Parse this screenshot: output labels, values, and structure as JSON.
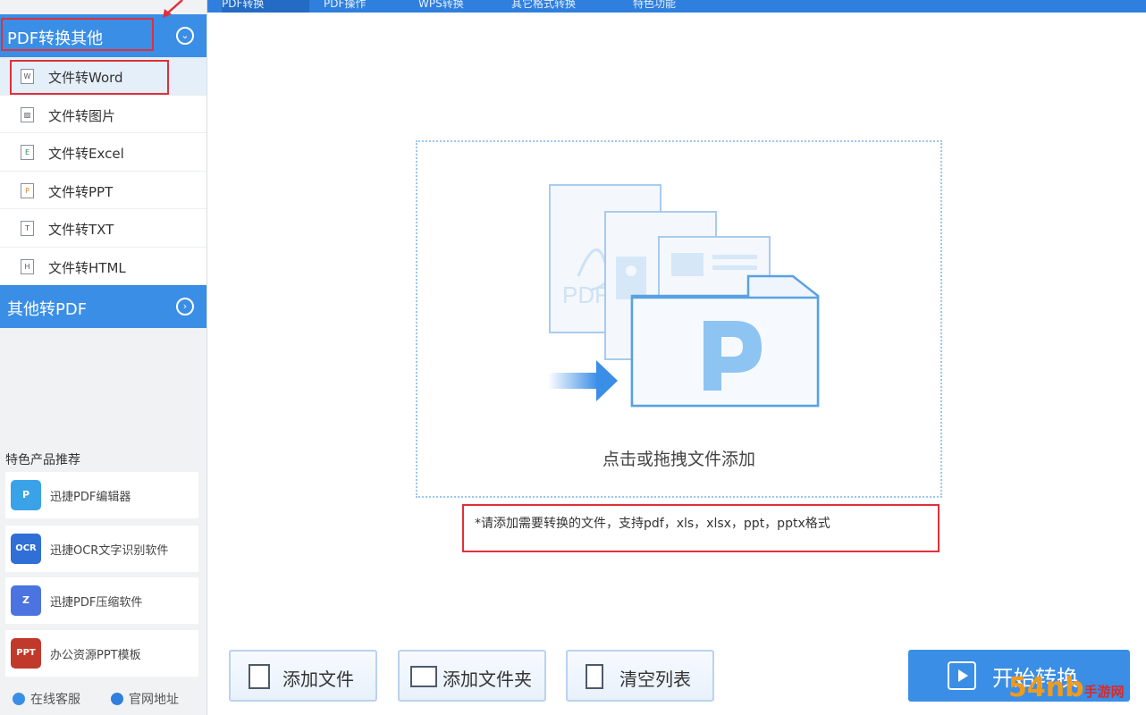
{
  "top_tabs": [
    {
      "label": "PDF转换",
      "active": true
    },
    {
      "label": "PDF操作",
      "active": false
    },
    {
      "label": "WPS转换",
      "active": false
    },
    {
      "label": "其它格式转换",
      "active": false
    },
    {
      "label": "特色功能",
      "active": false
    }
  ],
  "sidebar": {
    "group1": {
      "label": "PDF转换其他",
      "icon": "chevron-down-icon"
    },
    "items": [
      {
        "label": "文件转Word",
        "icon": "W",
        "active": true
      },
      {
        "label": "文件转图片",
        "icon": "img",
        "active": false
      },
      {
        "label": "文件转Excel",
        "icon": "E",
        "active": false
      },
      {
        "label": "文件转PPT",
        "icon": "P",
        "active": false
      },
      {
        "label": "文件转TXT",
        "icon": "T",
        "active": false
      },
      {
        "label": "文件转HTML",
        "icon": "H",
        "active": false
      }
    ],
    "group2": {
      "label": "其他转PDF",
      "icon": "chevron-right-icon"
    },
    "featured_title": "特色产品推荐",
    "products": [
      {
        "label": "迅捷PDF编辑器",
        "badge": "P",
        "color": "#3aa3e8"
      },
      {
        "label": "迅捷OCR文字识别软件",
        "badge": "OCR",
        "color": "#2f6fd6"
      },
      {
        "label": "迅捷PDF压缩软件",
        "badge": "Z",
        "color": "#4c74e0"
      },
      {
        "label": "办公资源PPT模板",
        "badge": "PPT",
        "color": "#c0392b"
      }
    ],
    "footer": {
      "service": "在线客服",
      "website": "官网地址"
    }
  },
  "main": {
    "drop_text": "点击或拖拽文件添加",
    "hint": "*请添加需要转换的文件，支持pdf，xls，xlsx，ppt，pptx格式",
    "drop_pdf_label": "PDF"
  },
  "buttons": {
    "add_file": "添加文件",
    "add_folder": "添加文件夹",
    "clear_list": "清空列表",
    "start": "开始转换"
  },
  "watermark": {
    "main": "54nb",
    "sub": "手游网"
  },
  "colors": {
    "accent": "#3a8ee6",
    "highlight_box": "#e0303a"
  }
}
